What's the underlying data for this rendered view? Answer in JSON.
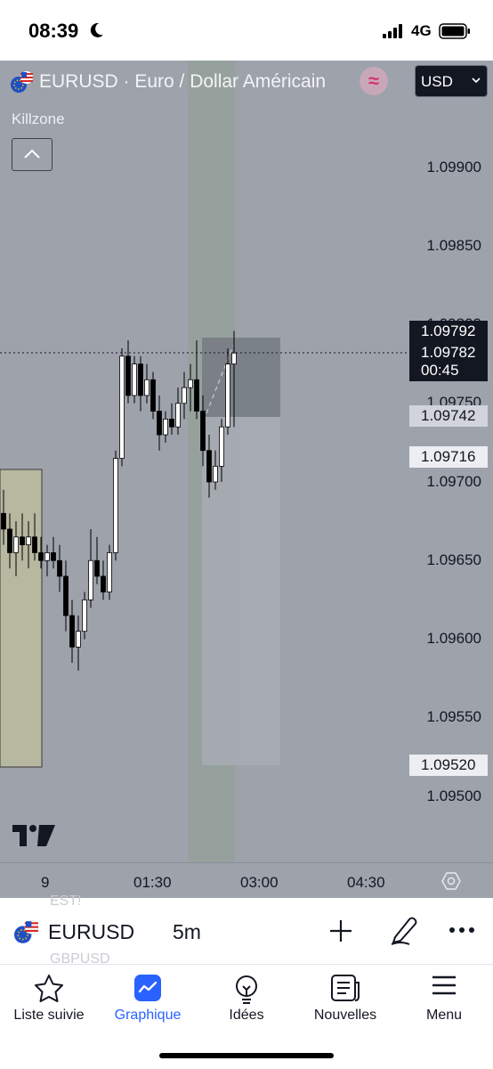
{
  "status_bar": {
    "time": "08:39",
    "network": "4G"
  },
  "header": {
    "symbol_title": "EURUSD · Euro / Dollar Américain",
    "indicator_badge": "≈",
    "currency": "USD"
  },
  "indicator": {
    "name": "Killzone"
  },
  "price_axis": {
    "ticks": [
      "1.09900",
      "1.09850",
      "1.09700",
      "1.09650",
      "1.09600",
      "1.09550",
      "1.09500"
    ],
    "partial_ticks": [
      "1.09800",
      "1.09750"
    ],
    "tags": {
      "high": "1.09792",
      "last": "1.09782",
      "countdown": "00:45",
      "level_a": "1.09742",
      "level_b": "1.09716",
      "level_c": "1.09520"
    }
  },
  "time_axis": {
    "labels": [
      "9",
      "01:30",
      "03:00",
      "04:30"
    ]
  },
  "toolbar": {
    "symbol": "EURUSD",
    "interval": "5m",
    "ghost_above": "EST!",
    "ghost_below": "GBPUSD"
  },
  "nav": {
    "items": [
      {
        "label": "Liste suivie",
        "icon": "star-icon",
        "active": false
      },
      {
        "label": "Graphique",
        "icon": "chart-icon",
        "active": true
      },
      {
        "label": "Idées",
        "icon": "lightbulb-icon",
        "active": false
      },
      {
        "label": "Nouvelles",
        "icon": "news-icon",
        "active": false
      },
      {
        "label": "Menu",
        "icon": "menu-icon",
        "active": false
      }
    ]
  },
  "colors": {
    "chart_background": "#9da2ab",
    "accent": "#2962ff",
    "killzone_fill": "#b7b8a0",
    "session_fill": "#8fa094",
    "candle_up": "#ffffff",
    "candle_down": "#000000"
  },
  "chart_data": {
    "type": "candlestick",
    "symbol": "EURUSD",
    "interval": "5m",
    "ylim": [
      1.0949,
      1.0992
    ],
    "candles": [
      {
        "o": 1.0968,
        "h": 1.09695,
        "l": 1.0966,
        "c": 1.0967
      },
      {
        "o": 1.0967,
        "h": 1.0968,
        "l": 1.09645,
        "c": 1.09655
      },
      {
        "o": 1.09655,
        "h": 1.09675,
        "l": 1.0964,
        "c": 1.09665
      },
      {
        "o": 1.09665,
        "h": 1.0968,
        "l": 1.0965,
        "c": 1.0966
      },
      {
        "o": 1.0966,
        "h": 1.09675,
        "l": 1.09645,
        "c": 1.09665
      },
      {
        "o": 1.09665,
        "h": 1.0968,
        "l": 1.0965,
        "c": 1.09655
      },
      {
        "o": 1.09655,
        "h": 1.09665,
        "l": 1.09645,
        "c": 1.0965
      },
      {
        "o": 1.0965,
        "h": 1.0966,
        "l": 1.0964,
        "c": 1.09655
      },
      {
        "o": 1.09655,
        "h": 1.09665,
        "l": 1.09645,
        "c": 1.0965
      },
      {
        "o": 1.0965,
        "h": 1.0966,
        "l": 1.0963,
        "c": 1.0964
      },
      {
        "o": 1.0964,
        "h": 1.0965,
        "l": 1.09605,
        "c": 1.09615
      },
      {
        "o": 1.09615,
        "h": 1.09625,
        "l": 1.09585,
        "c": 1.09595
      },
      {
        "o": 1.09595,
        "h": 1.09615,
        "l": 1.0958,
        "c": 1.09605
      },
      {
        "o": 1.09605,
        "h": 1.0963,
        "l": 1.096,
        "c": 1.09625
      },
      {
        "o": 1.09625,
        "h": 1.0967,
        "l": 1.0962,
        "c": 1.0965
      },
      {
        "o": 1.0965,
        "h": 1.09665,
        "l": 1.09635,
        "c": 1.0964
      },
      {
        "o": 1.0964,
        "h": 1.0965,
        "l": 1.09625,
        "c": 1.0963
      },
      {
        "o": 1.0963,
        "h": 1.0966,
        "l": 1.09625,
        "c": 1.09655
      },
      {
        "o": 1.09655,
        "h": 1.0972,
        "l": 1.0965,
        "c": 1.09715
      },
      {
        "o": 1.09715,
        "h": 1.09785,
        "l": 1.0971,
        "c": 1.0978
      },
      {
        "o": 1.0978,
        "h": 1.0979,
        "l": 1.0975,
        "c": 1.09755
      },
      {
        "o": 1.09755,
        "h": 1.0978,
        "l": 1.0975,
        "c": 1.09775
      },
      {
        "o": 1.09775,
        "h": 1.0978,
        "l": 1.09745,
        "c": 1.09755
      },
      {
        "o": 1.09755,
        "h": 1.09775,
        "l": 1.0975,
        "c": 1.09765
      },
      {
        "o": 1.09765,
        "h": 1.0977,
        "l": 1.0974,
        "c": 1.09745
      },
      {
        "o": 1.09745,
        "h": 1.09755,
        "l": 1.0972,
        "c": 1.0973
      },
      {
        "o": 1.0973,
        "h": 1.09745,
        "l": 1.09725,
        "c": 1.0974
      },
      {
        "o": 1.0974,
        "h": 1.0975,
        "l": 1.0973,
        "c": 1.09735
      },
      {
        "o": 1.09735,
        "h": 1.0976,
        "l": 1.0973,
        "c": 1.0975
      },
      {
        "o": 1.0975,
        "h": 1.0977,
        "l": 1.0974,
        "c": 1.0976
      },
      {
        "o": 1.0976,
        "h": 1.09775,
        "l": 1.09745,
        "c": 1.09765
      },
      {
        "o": 1.09765,
        "h": 1.0979,
        "l": 1.0974,
        "c": 1.09745
      },
      {
        "o": 1.09745,
        "h": 1.09755,
        "l": 1.0971,
        "c": 1.0972
      },
      {
        "o": 1.0972,
        "h": 1.0973,
        "l": 1.0969,
        "c": 1.097
      },
      {
        "o": 1.097,
        "h": 1.0972,
        "l": 1.09695,
        "c": 1.0971
      },
      {
        "o": 1.0971,
        "h": 1.0974,
        "l": 1.097,
        "c": 1.09735
      },
      {
        "o": 1.09735,
        "h": 1.09785,
        "l": 1.0973,
        "c": 1.09775
      },
      {
        "o": 1.09775,
        "h": 1.09796,
        "l": 1.09735,
        "c": 1.09782
      }
    ]
  }
}
